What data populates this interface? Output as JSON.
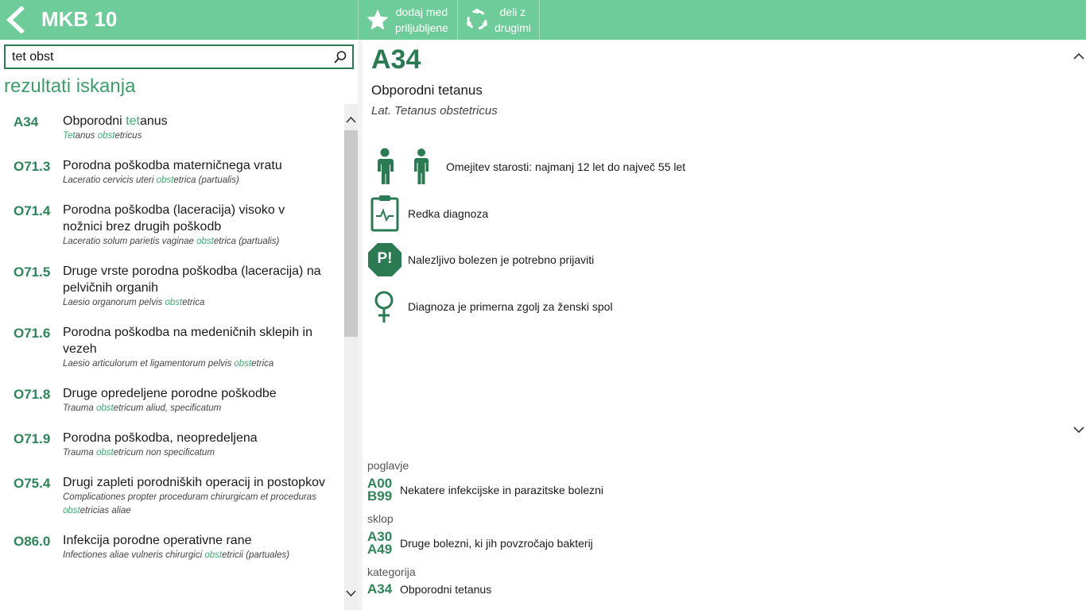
{
  "header": {
    "app_title": "MKB 10",
    "favorite_label": "dodaj med\npriljubljene",
    "share_label": "deli z\ndrugimi",
    "bg_color": "#6dcc9a"
  },
  "search": {
    "value": "tet obst"
  },
  "results_title": "rezultati iskanja",
  "results": [
    {
      "code": "A34",
      "title": [
        [
          "Obporodni ",
          false
        ],
        [
          "tet",
          true
        ],
        [
          "anus",
          false
        ]
      ],
      "latin": [
        [
          "Tet",
          true
        ],
        [
          "anus ",
          false
        ],
        [
          "obst",
          true
        ],
        [
          "etricus",
          false
        ]
      ]
    },
    {
      "code": "O71.3",
      "title": [
        [
          "Porodna poškodba materničnega vratu",
          false
        ]
      ],
      "latin": [
        [
          "Laceratio cervicis uteri ",
          false
        ],
        [
          "obst",
          true
        ],
        [
          "etrica (partualis)",
          false
        ]
      ]
    },
    {
      "code": "O71.4",
      "title": [
        [
          "Porodna poškodba (laceracija) visoko v nožnici brez drugih poškodb",
          false
        ]
      ],
      "latin": [
        [
          "Laceratio solum parietis vaginae ",
          false
        ],
        [
          "obst",
          true
        ],
        [
          "etrica (partualis)",
          false
        ]
      ]
    },
    {
      "code": "O71.5",
      "title": [
        [
          "Druge vrste porodna poškodba (laceracija) na pelvičnih organih",
          false
        ]
      ],
      "latin": [
        [
          "Laesio organorum pelvis ",
          false
        ],
        [
          "obst",
          true
        ],
        [
          "etrica",
          false
        ]
      ]
    },
    {
      "code": "O71.6",
      "title": [
        [
          "Porodna poškodba na medeničnih sklepih in vezeh",
          false
        ]
      ],
      "latin": [
        [
          "Laesio articulorum et ligamentorum pelvis ",
          false
        ],
        [
          "obst",
          true
        ],
        [
          "etrica",
          false
        ]
      ]
    },
    {
      "code": "O71.8",
      "title": [
        [
          "Druge opredeljene porodne poškodbe",
          false
        ]
      ],
      "latin": [
        [
          "Trauma ",
          false
        ],
        [
          "obst",
          true
        ],
        [
          "etricum aliud, specificatum",
          false
        ]
      ]
    },
    {
      "code": "O71.9",
      "title": [
        [
          "Porodna poškodba, neopredeljena",
          false
        ]
      ],
      "latin": [
        [
          "Trauma ",
          false
        ],
        [
          "obst",
          true
        ],
        [
          "etricum non specificatum",
          false
        ]
      ]
    },
    {
      "code": "O75.4",
      "title": [
        [
          "Drugi zapleti porodniških operacij in postopkov",
          false
        ]
      ],
      "latin": [
        [
          "Complicationes propter proceduram chirurgicam et proceduras ",
          false
        ],
        [
          "obst",
          true
        ],
        [
          "etricias aliae",
          false
        ]
      ]
    },
    {
      "code": "O86.0",
      "title": [
        [
          "Infekcija porodne operativne rane",
          false
        ]
      ],
      "latin": [
        [
          "Infectiones aliae vulneris chirurgici ",
          false
        ],
        [
          "obst",
          true
        ],
        [
          "etricii (partuales)",
          false
        ]
      ]
    }
  ],
  "detail": {
    "code": "A34",
    "title": "Obporodni tetanus",
    "latin": "Lat. Tetanus obstetricus",
    "age_restriction": "Omejitev starosti: najmanj 12 let do največ 55 let",
    "rare": "Redka diagnoza",
    "notifiable": "Nalezljivo bolezen je potrebno prijaviti",
    "notifiable_badge": "P!",
    "sex": "Diagnoza je primerna zgolj za ženski spol"
  },
  "hierarchy": {
    "chapter_label": "poglavje",
    "chapter_from": "A00",
    "chapter_to": "B99",
    "chapter_name": "Nekatere infekcijske in parazitske bolezni",
    "block_label": "sklop",
    "block_from": "A30",
    "block_to": "A49",
    "block_name": "Druge bolezni, ki jih povzročajo bakterij",
    "category_label": "kategorija",
    "category_code": "A34",
    "category_name": "Obporodni tetanus"
  },
  "accent_color": "#2a7a52",
  "highlight_color": "#3fa972"
}
